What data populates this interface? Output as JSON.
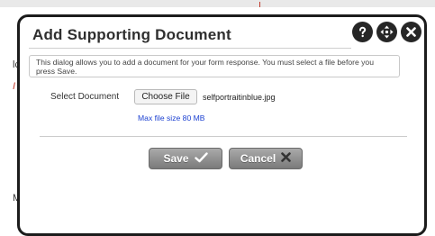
{
  "background": {
    "fragments": [
      "lc",
      "I",
      "M",
      "I"
    ]
  },
  "dialog": {
    "title": "Add Supporting Document",
    "icons": [
      "help-icon",
      "move-icon",
      "close-icon"
    ],
    "info_text": "This dialog allows you to add a document for your form response. You must select a file before you press Save.",
    "select_label": "Select Document",
    "choose_button_label": "Choose File",
    "file_name": "selfportraitinblue.jpg",
    "max_size_text": "Max file size 80 MB",
    "save_label": "Save",
    "cancel_label": "Cancel",
    "colors": {
      "link": "#1a3fd1",
      "button": "#8f8f8f",
      "icon_bg": "#262626"
    }
  }
}
